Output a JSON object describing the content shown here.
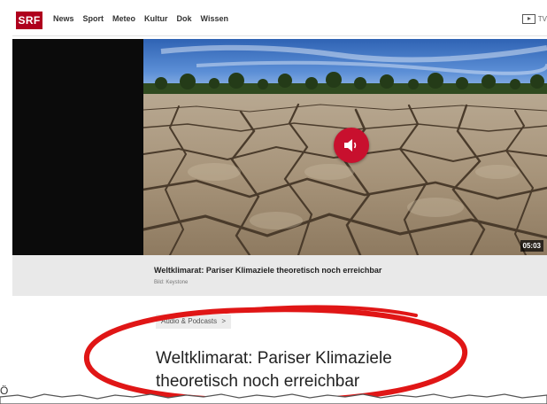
{
  "header": {
    "logo": "SRF",
    "nav": [
      "News",
      "Sport",
      "Meteo",
      "Kultur",
      "Dok",
      "Wissen"
    ],
    "tv_label": "TV"
  },
  "media": {
    "duration": "05:03",
    "caption_title": "Weltklimarat: Pariser Klimaziele theoretisch noch erreichbar",
    "caption_credit": "Bild: Keystone"
  },
  "article": {
    "category": "Audio & Podcasts",
    "category_chevron": ">",
    "headline_line1": "Weltklimarat: Pariser Klimaziele",
    "headline_line2": "theoretisch noch erreichbar"
  },
  "side_char": "Ö",
  "colors": {
    "brand_red": "#af001d",
    "button_red": "#c8102e",
    "annotation_red": "#e01616"
  }
}
